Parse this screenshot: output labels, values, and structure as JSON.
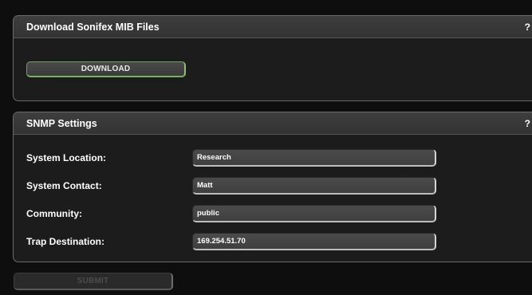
{
  "mib_panel": {
    "title": "Download Sonifex MIB Files",
    "help": "?",
    "download_label": "DOWNLOAD"
  },
  "snmp_panel": {
    "title": "SNMP Settings",
    "help": "?",
    "fields": [
      {
        "label": "System Location:",
        "value": "Research"
      },
      {
        "label": "System Contact:",
        "value": "Matt"
      },
      {
        "label": "Community:",
        "value": "public"
      },
      {
        "label": "Trap Destination:",
        "value": "169.254.51.70"
      }
    ]
  },
  "submit_label": "SUBMIT",
  "colors": {
    "background": "#0e0e0e",
    "panel": "#1c1c1c",
    "header": "#383838",
    "download_border_accent": "#8ec070",
    "submit_disabled_text": "#4d4d4d"
  }
}
